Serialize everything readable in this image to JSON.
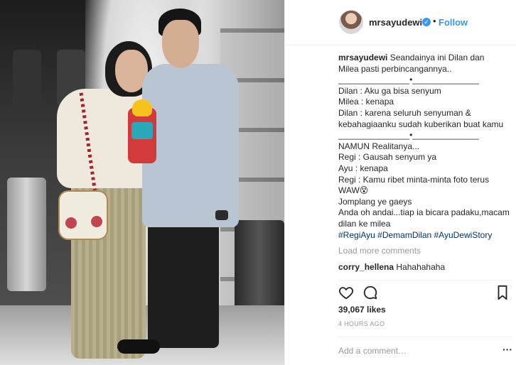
{
  "post": {
    "username": "mrsayudewi",
    "dot": "•",
    "follow_label": "Follow",
    "verified_glyph": "✓"
  },
  "caption": {
    "username": "mrsayudewi",
    "lines": [
      "Seandainya ini Dilan dan",
      "Milea pasti perbincangannya..",
      "_______________•______________",
      "Dilan : Aku ga bisa senyum",
      "Milea : kenapa",
      "Dilan : karena seluruh senyuman &",
      "kebahagiaanku sudah kuberikan buat kamu",
      "_______________•______________",
      "NAMUN Realitanya...",
      "Regi : Gausah senyum ya",
      "Ayu : kenapa",
      "Regi : Kamu ribet minta-minta foto terus",
      "WAW",
      "Jomplang ye gaeys",
      "Anda oh andai...tiap ia bicara padaku,macam",
      "dilan ke milea"
    ],
    "waw_emoji": "😵",
    "hashtags": "#RegiAyu #DemamDilan #AyuDewiStory"
  },
  "load_more": "Load more comments",
  "comment": {
    "username": "corry_hellena",
    "text": "Hahahahaha"
  },
  "likes": "39,067 likes",
  "time_ago": "4 HOURS AGO",
  "add_comment_placeholder": "Add a comment…",
  "more_glyph": "···",
  "icons": {
    "like": "heart-icon",
    "comment": "comment-bubble-icon",
    "save": "bookmark-icon"
  },
  "colors": {
    "link_blue": "#3897f0",
    "hashtag": "#003569",
    "muted": "#999999",
    "text": "#262626"
  }
}
